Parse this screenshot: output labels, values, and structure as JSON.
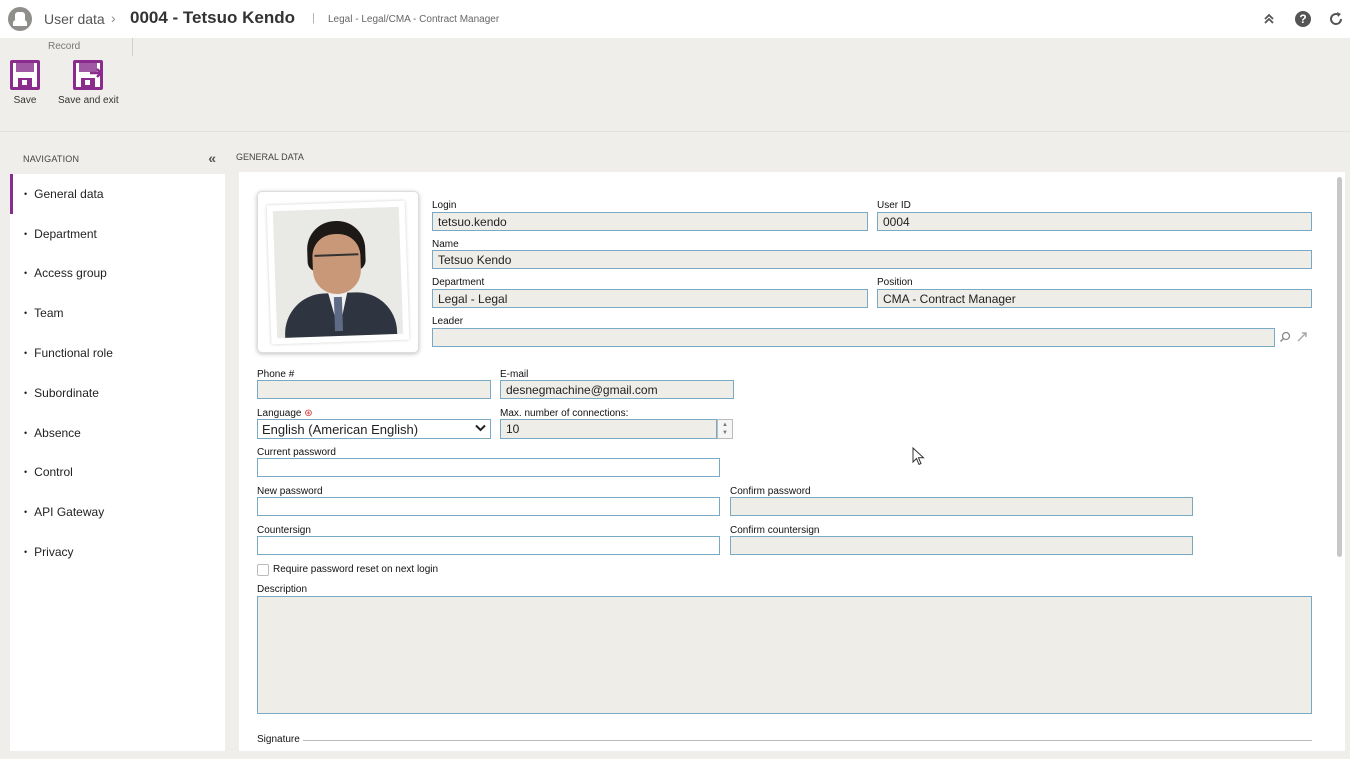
{
  "header": {
    "crumb_root": "User data",
    "crumb_separator": "›",
    "title": "0004 - Tetsuo Kendo",
    "bar": "|",
    "subtitle": "Legal - Legal/CMA - Contract Manager",
    "icons": [
      "collapse-up-icon",
      "help-icon",
      "refresh-icon"
    ]
  },
  "ribbon": {
    "group_label": "Record",
    "save_label": "Save",
    "save_exit_label": "Save and exit",
    "accent_color": "#8a2b8d"
  },
  "nav": {
    "title": "NAVIGATION",
    "items": [
      {
        "label": "General data",
        "active": true
      },
      {
        "label": "Department"
      },
      {
        "label": "Access group"
      },
      {
        "label": "Team"
      },
      {
        "label": "Functional role"
      },
      {
        "label": "Subordinate"
      },
      {
        "label": "Absence"
      },
      {
        "label": "Control"
      },
      {
        "label": "API Gateway"
      },
      {
        "label": "Privacy"
      }
    ]
  },
  "main": {
    "section_title": "GENERAL DATA",
    "fields": {
      "login": {
        "label": "Login",
        "value": "tetsuo.kendo"
      },
      "user_id": {
        "label": "User ID",
        "value": "0004"
      },
      "name": {
        "label": "Name",
        "value": "Tetsuo Kendo"
      },
      "department": {
        "label": "Department",
        "value": "Legal - Legal"
      },
      "position": {
        "label": "Position",
        "value": "CMA - Contract Manager"
      },
      "leader": {
        "label": "Leader",
        "value": ""
      },
      "phone": {
        "label": "Phone #",
        "value": ""
      },
      "email": {
        "label": "E-mail",
        "value": "desnegmachine@gmail.com"
      },
      "language": {
        "label": "Language",
        "value": "English (American English)",
        "required_mark": "⊛"
      },
      "max_connections": {
        "label": "Max. number of connections:",
        "value": "10"
      },
      "current_password": {
        "label": "Current password",
        "value": ""
      },
      "new_password": {
        "label": "New password",
        "value": ""
      },
      "confirm_password": {
        "label": "Confirm password",
        "value": ""
      },
      "countersign": {
        "label": "Countersign",
        "value": ""
      },
      "confirm_countersign": {
        "label": "Confirm countersign",
        "value": ""
      },
      "require_reset": {
        "label": "Require password reset on next login",
        "checked": false
      },
      "description": {
        "label": "Description",
        "value": ""
      },
      "signature": {
        "label": "Signature"
      }
    }
  }
}
